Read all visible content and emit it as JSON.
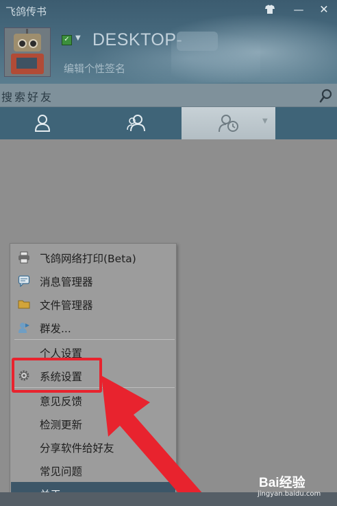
{
  "window": {
    "title": "飞鸽传书",
    "buttons": {
      "skin": "skin-icon",
      "minimize": "—",
      "close": "✕"
    }
  },
  "profile": {
    "status_icon": "online-status-icon",
    "username": "DESKTOP-",
    "signature_placeholder": "编辑个性签名"
  },
  "search": {
    "placeholder": "搜索好友",
    "icon": "search-icon"
  },
  "tabs": [
    {
      "id": "contacts",
      "icon": "person-icon",
      "active": false
    },
    {
      "id": "groups",
      "icon": "people-icon",
      "active": false
    },
    {
      "id": "recent",
      "icon": "recent-contacts-icon",
      "active": true
    }
  ],
  "menu": {
    "items": [
      {
        "label": "飞鸽网络打印(Beta)",
        "icon": "printer-icon"
      },
      {
        "label": "消息管理器",
        "icon": "message-icon"
      },
      {
        "label": "文件管理器",
        "icon": "folder-icon"
      },
      {
        "label": "群发...",
        "icon": "broadcast-icon"
      },
      {
        "label": "个人设置",
        "icon": ""
      },
      {
        "label": "系统设置",
        "icon": "gear-icon"
      },
      {
        "label": "意见反馈",
        "icon": ""
      },
      {
        "label": "检测更新",
        "icon": ""
      },
      {
        "label": "分享软件给好友",
        "icon": ""
      },
      {
        "label": "常见问题",
        "icon": ""
      },
      {
        "label": "关于...",
        "icon": ""
      }
    ],
    "highlighted_index": 10,
    "annotated_index": 5
  },
  "annotation": {
    "color": "#e8232e"
  },
  "watermark": {
    "main": "Bai经验",
    "sub": "jingyan.baidu.com"
  },
  "colors": {
    "header": "#476a7e",
    "tabbar": "#3f6478",
    "menu_bg": "#9c9c9c",
    "menu_highlight": "#3c5668"
  }
}
